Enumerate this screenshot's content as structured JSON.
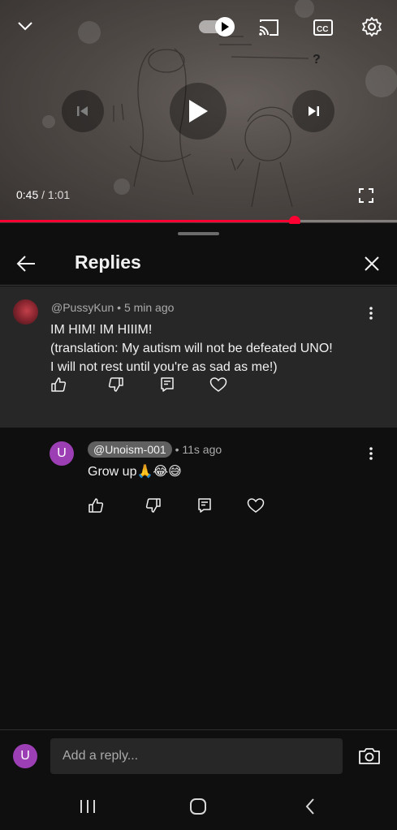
{
  "player": {
    "time_current": "0:45",
    "time_separator": " / ",
    "time_total": "1:01",
    "progress_fraction": 0.743,
    "icons": [
      "chevron-down-icon",
      "autoplay-toggle-icon",
      "cast-icon",
      "closed-captions-icon",
      "settings-icon",
      "previous-icon",
      "play-icon",
      "next-icon",
      "fullscreen-icon"
    ],
    "accent_color": "#ff0033"
  },
  "panel": {
    "title": "Replies"
  },
  "parent_comment": {
    "author": "@PussyKun",
    "age": "5 min ago",
    "line1": "IM HIM! IM HIIIM!",
    "line2": "(translation: My autism will not be defeated UNO!",
    "line3": "I will not rest until you're as sad as me!)"
  },
  "reply_comment": {
    "avatar_letter": "U",
    "author": "@Unoism-001",
    "age": "11s ago",
    "text": "Grow up🙏😂😅"
  },
  "reply_bar": {
    "avatar_letter": "U",
    "placeholder": "Add a reply..."
  },
  "separator": "•",
  "colors": {
    "avatar_purple": "#9c3fb5",
    "background": "#0f0f0f",
    "parent_bg": "#272727"
  }
}
